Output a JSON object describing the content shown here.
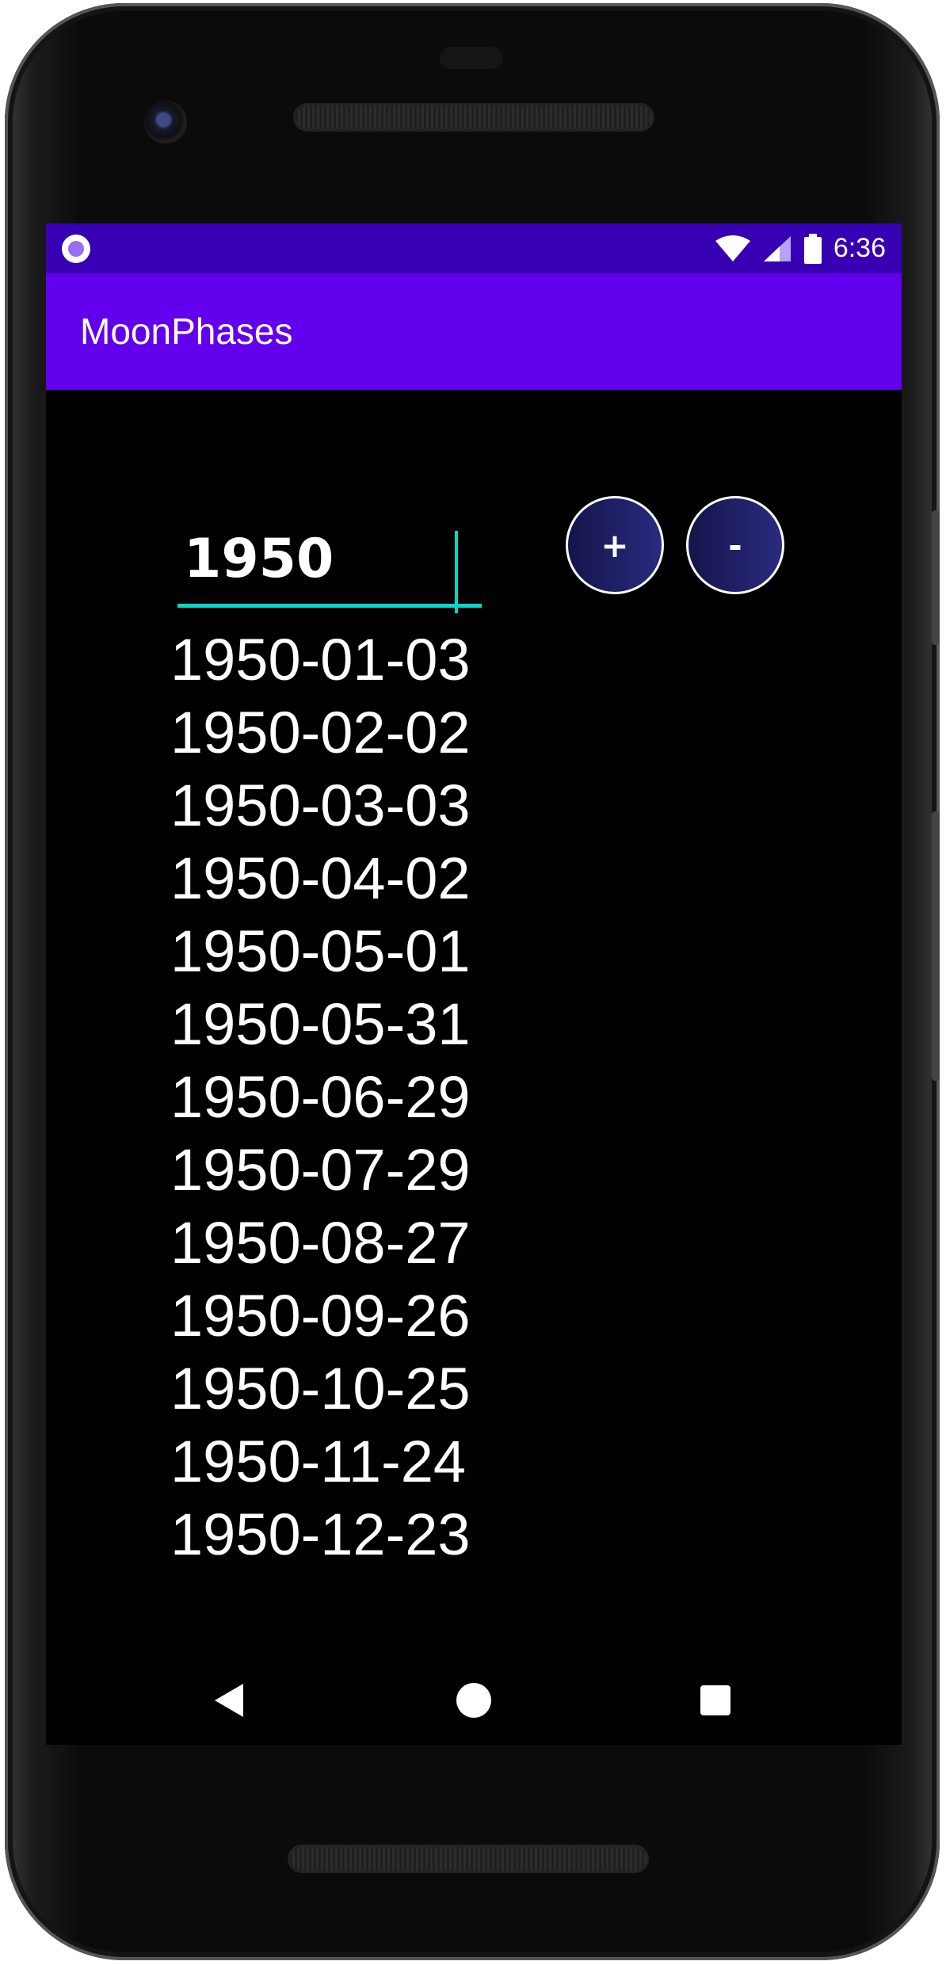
{
  "status_bar": {
    "time": "6:36",
    "icons": [
      "notification-dot-icon",
      "wifi-icon",
      "cell-signal-icon",
      "battery-icon"
    ]
  },
  "app_bar": {
    "title": "MoonPhases"
  },
  "year_input": {
    "value": "1950"
  },
  "buttons": {
    "plus_label": "+",
    "minus_label": "-"
  },
  "dates": [
    "1950-01-03",
    "1950-02-02",
    "1950-03-03",
    "1950-04-02",
    "1950-05-01",
    "1950-05-31",
    "1950-06-29",
    "1950-07-29",
    "1950-08-27",
    "1950-09-26",
    "1950-10-25",
    "1950-11-24",
    "1950-12-23"
  ],
  "nav_bar": {
    "icons": [
      "back-icon",
      "home-icon",
      "recents-icon"
    ]
  },
  "colors": {
    "status_bar": "#3700b3",
    "app_bar": "#6200ee",
    "accent": "#03dac5",
    "background": "#000000"
  }
}
